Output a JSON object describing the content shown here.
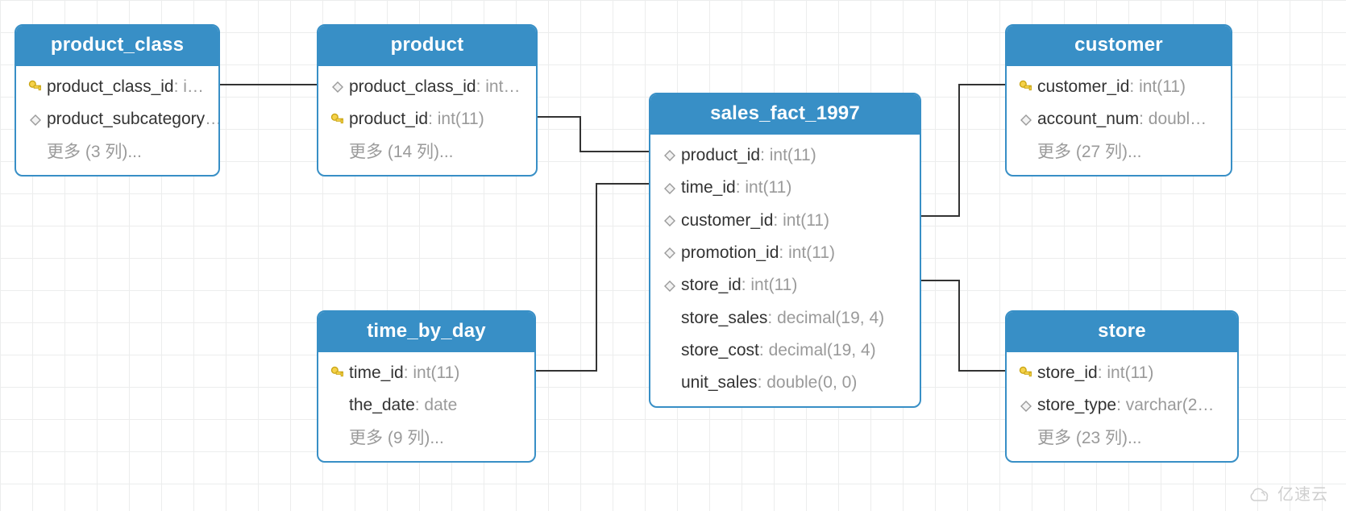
{
  "colors": {
    "accent": "#388fc6",
    "muted": "#9a9a9a",
    "text": "#333333",
    "grid": "#eceded"
  },
  "watermark": "亿速云",
  "entities": {
    "product_class": {
      "title": "product_class",
      "columns": [
        {
          "key": "pk",
          "name": "product_class_id",
          "type": "i…"
        },
        {
          "key": "field",
          "name": "product_subcategory",
          "type": "…"
        }
      ],
      "more": "更多 (3 列)..."
    },
    "product": {
      "title": "product",
      "columns": [
        {
          "key": "field",
          "name": "product_class_id",
          "type": "int…"
        },
        {
          "key": "pk",
          "name": "product_id",
          "type": "int(11)"
        }
      ],
      "more": "更多 (14 列)..."
    },
    "time_by_day": {
      "title": "time_by_day",
      "columns": [
        {
          "key": "pk",
          "name": "time_id",
          "type": "int(11)"
        },
        {
          "key": "field",
          "name": "the_date",
          "type": "date"
        }
      ],
      "more": "更多 (9 列)..."
    },
    "sales_fact_1997": {
      "title": "sales_fact_1997",
      "columns": [
        {
          "key": "field",
          "name": "product_id",
          "type": "int(11)"
        },
        {
          "key": "field",
          "name": "time_id",
          "type": "int(11)"
        },
        {
          "key": "field",
          "name": "customer_id",
          "type": "int(11)"
        },
        {
          "key": "field",
          "name": "promotion_id",
          "type": "int(11)"
        },
        {
          "key": "field",
          "name": "store_id",
          "type": "int(11)"
        },
        {
          "key": "none",
          "name": "store_sales",
          "type": "decimal(19, 4)"
        },
        {
          "key": "none",
          "name": "store_cost",
          "type": "decimal(19, 4)"
        },
        {
          "key": "none",
          "name": "unit_sales",
          "type": "double(0, 0)"
        }
      ]
    },
    "customer": {
      "title": "customer",
      "columns": [
        {
          "key": "pk",
          "name": "customer_id",
          "type": "int(11)"
        },
        {
          "key": "field",
          "name": "account_num",
          "type": "doubl…"
        }
      ],
      "more": "更多 (27 列)..."
    },
    "store": {
      "title": "store",
      "columns": [
        {
          "key": "pk",
          "name": "store_id",
          "type": "int(11)"
        },
        {
          "key": "field",
          "name": "store_type",
          "type": "varchar(2…"
        }
      ],
      "more": "更多 (23 列)..."
    }
  },
  "relations": [
    {
      "from": "product_class",
      "to": "product",
      "via": "product_class_id"
    },
    {
      "from": "product",
      "to": "sales_fact_1997",
      "via": "product_id"
    },
    {
      "from": "time_by_day",
      "to": "sales_fact_1997",
      "via": "time_id"
    },
    {
      "from": "customer",
      "to": "sales_fact_1997",
      "via": "customer_id"
    },
    {
      "from": "store",
      "to": "sales_fact_1997",
      "via": "store_id"
    }
  ]
}
